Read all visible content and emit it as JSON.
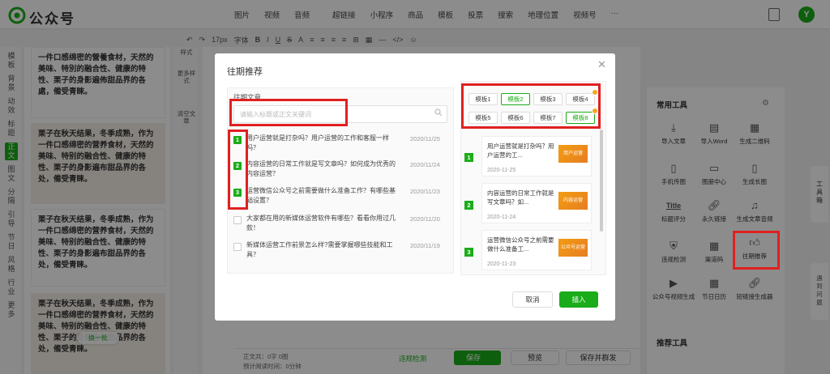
{
  "app": {
    "title": "公众号"
  },
  "top_menu": [
    "图片",
    "视频",
    "音频",
    "超链接",
    "小程序",
    "商品",
    "模板",
    "投票",
    "搜索",
    "地理位置",
    "视频号",
    "···"
  ],
  "format_toolbar": [
    "↶",
    "↷",
    "17px",
    "字体",
    "B",
    "I",
    "U",
    "S",
    "A",
    "≡",
    "≡",
    "≡",
    "≡",
    "⊞",
    "▦",
    "—",
    "</>",
    "☺"
  ],
  "categories": [
    "模板",
    "背景",
    "动效",
    "标题",
    "正文",
    "图文",
    "分隔",
    "引导",
    "节日",
    "风格",
    "行业",
    "更多"
  ],
  "active_category": "正文",
  "template_text": "栗子在秋天结果，冬季成熟，作为一件口感绵密的营养食材，天然的美味、特别的融合性、健康的特性、栗子的身影遍布甜品界的各处，備受青睐。",
  "template_text_lead": "一件口感绵密的營養食材，天然的美味、特別的融合性、健康的特性、栗子的身影遍佈甜品界的各處，備受青睞。",
  "swap_label": "换一批",
  "side_buttons": [
    "样式",
    "更多样式",
    "清空文章"
  ],
  "modal": {
    "title": "往期推荐",
    "section_label": "往期文章",
    "search_placeholder": "请输入标题或正文关键词",
    "articles": [
      {
        "num": "1",
        "title": "用户运营就是打杂吗？用户运营的工作和客服一样吗？",
        "date": "2020/11/25"
      },
      {
        "num": "2",
        "title": "内容运营的日常工作就是写文章吗？如何成为优秀的内容运营？",
        "date": "2020/11/24"
      },
      {
        "num": "3",
        "title": "运营微信公众号之前需要做什么准备工作？有哪些基础设置？",
        "date": "2020/11/23"
      },
      {
        "num": "",
        "title": "大家都在用的新媒体运营软件有哪些？看看你用过几款！",
        "date": "2020/11/20"
      },
      {
        "num": "",
        "title": "新媒体运营工作前景怎么样?需要掌握哪些技能和工具？",
        "date": "2020/11/19"
      }
    ],
    "templates": [
      "模板1",
      "模板2",
      "模板3",
      "模板4",
      "模板5",
      "模板6",
      "模板7",
      "模板8"
    ],
    "preview": [
      {
        "num": "1",
        "title": "用户运营就是打杂吗？用户运营的工...",
        "date": "2020-11-25",
        "thumb": "用户运营"
      },
      {
        "num": "2",
        "title": "内容运营的日常工作就是写文章吗？如...",
        "date": "2020-11-24",
        "thumb": "内容运营"
      },
      {
        "num": "3",
        "title": "运营微信公众号之前需要做什么准备工...",
        "date": "2020-11-23",
        "thumb": "公众号运营"
      }
    ],
    "cancel": "取消",
    "insert": "插入"
  },
  "right_panel": {
    "title": "常用工具",
    "tools": [
      "导入文章",
      "导入Word",
      "生成二维码",
      "手机传图",
      "图册中心",
      "生成长图",
      "标题评分",
      "永久链接",
      "生成文章音频",
      "违规检测",
      "渠道码",
      "往期推荐",
      "公众号视频生成",
      "节日日历",
      "短链接生成器"
    ],
    "title2": "推荐工具",
    "rail1": "工具箱",
    "rail2": "遇到问题"
  },
  "bottom": {
    "word_count": "正文共：0字 0图",
    "read_time": "预计阅读时间：0分钟",
    "violation": "违规检测",
    "save": "保存",
    "preview": "预览",
    "save_send": "保存并群发"
  },
  "colors": {
    "accent": "#1aad19",
    "highlight": "#e02020"
  }
}
